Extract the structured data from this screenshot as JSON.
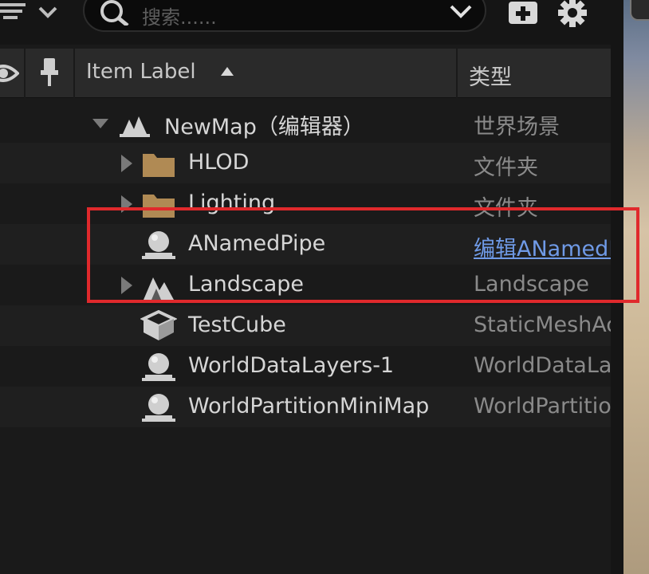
{
  "search": {
    "placeholder": "搜索......"
  },
  "header": {
    "item_label": "Item Label",
    "type_label": "类型"
  },
  "rows": [
    {
      "label": "NewMap（编辑器）",
      "type": "世界场景",
      "icon": "world-icon",
      "arrow": "expanded"
    },
    {
      "label": "HLOD",
      "type": "文件夹",
      "icon": "folder-icon",
      "arrow": "collapsed"
    },
    {
      "label": "Lighting",
      "type": "文件夹",
      "icon": "folder-icon",
      "arrow": "collapsed"
    },
    {
      "label": "ANamedPipe",
      "type": "编辑ANamedPipe",
      "icon": "actor-icon",
      "arrow": "none",
      "type_is_link": true
    },
    {
      "label": "Landscape",
      "type": "Landscape",
      "icon": "landscape-icon",
      "arrow": "collapsed"
    },
    {
      "label": "TestCube",
      "type": "StaticMeshActor",
      "icon": "static-mesh-icon",
      "arrow": "none"
    },
    {
      "label": "WorldDataLayers-1",
      "type": "WorldDataLayers",
      "icon": "actor-icon",
      "arrow": "none"
    },
    {
      "label": "WorldPartitionMiniMap",
      "type": "WorldPartitionMiniMap",
      "icon": "actor-icon",
      "arrow": "none"
    }
  ],
  "colors": {
    "highlight": "#e0292c",
    "link": "#6f9ae6",
    "folder": "#b08a54"
  }
}
